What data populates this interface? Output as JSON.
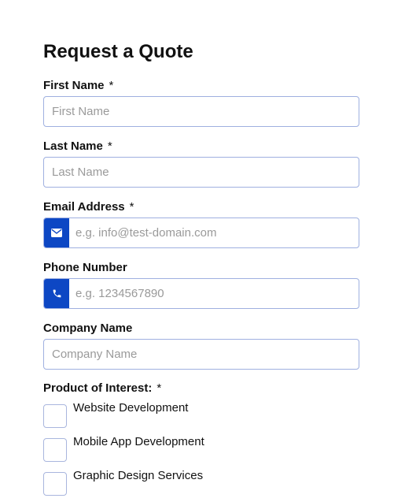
{
  "form": {
    "title": "Request a Quote",
    "required_marker": "*",
    "first_name": {
      "label": "First Name",
      "placeholder": "First Name",
      "value": ""
    },
    "last_name": {
      "label": "Last Name",
      "placeholder": "Last Name",
      "value": ""
    },
    "email": {
      "label": "Email Address",
      "placeholder": "e.g. info@test-domain.com",
      "value": "",
      "icon": "envelope-icon"
    },
    "phone": {
      "label": "Phone Number",
      "placeholder": "e.g. 1234567890",
      "value": "",
      "icon": "phone-icon"
    },
    "company": {
      "label": "Company Name",
      "placeholder": "Company Name",
      "value": ""
    },
    "products": {
      "label": "Product of Interest:",
      "options": [
        {
          "label": "Website Development",
          "checked": false
        },
        {
          "label": "Mobile App Development",
          "checked": false
        },
        {
          "label": "Graphic Design Services",
          "checked": false
        }
      ]
    }
  },
  "colors": {
    "accent": "#0d47c4",
    "input_border": "#9fb0e0",
    "placeholder": "#9a9a9a"
  }
}
